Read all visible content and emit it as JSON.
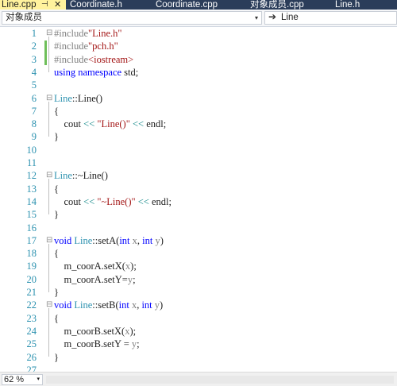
{
  "tabs": [
    {
      "label": "Line.cpp",
      "active": true
    },
    {
      "label": "Coordinate.h"
    },
    {
      "label": "Coordinate.cpp"
    },
    {
      "label": "对象成员.cpp"
    },
    {
      "label": "Line.h"
    }
  ],
  "tab_icons": {
    "pin": "pin-icon",
    "close": "close-icon"
  },
  "navbar": {
    "scope_label": "对象成员",
    "member_label": "Line",
    "dropdown_glyph": "▾",
    "member_arrow_glyph": "➔"
  },
  "editor": {
    "lines": [
      {
        "n": "1",
        "collapse": "⊟",
        "parts": [
          {
            "c": "pp",
            "t": "#include"
          },
          {
            "c": "str",
            "t": "\"Line.h\""
          }
        ]
      },
      {
        "n": "2",
        "parts": [
          {
            "c": "pp",
            "t": "#include"
          },
          {
            "c": "str",
            "t": "\"pch.h\""
          }
        ]
      },
      {
        "n": "3",
        "parts": [
          {
            "c": "pp",
            "t": "#include"
          },
          {
            "c": "str",
            "t": "<iostream>"
          }
        ]
      },
      {
        "n": "4",
        "parts": [
          {
            "c": "kw",
            "t": "using"
          },
          {
            "c": "",
            "t": " "
          },
          {
            "c": "kw",
            "t": "namespace"
          },
          {
            "c": "",
            "t": " std;"
          }
        ]
      },
      {
        "n": "5",
        "parts": []
      },
      {
        "n": "6",
        "collapse": "⊟",
        "parts": [
          {
            "c": "cls",
            "t": "Line"
          },
          {
            "c": "",
            "t": "::Line()"
          }
        ]
      },
      {
        "n": "7",
        "parts": [
          {
            "c": "",
            "t": "{"
          }
        ]
      },
      {
        "n": "8",
        "parts": [
          {
            "c": "",
            "t": "    cout "
          },
          {
            "c": "op",
            "t": "<<"
          },
          {
            "c": "",
            "t": " "
          },
          {
            "c": "str",
            "t": "\"Line()\""
          },
          {
            "c": "",
            "t": " "
          },
          {
            "c": "op",
            "t": "<<"
          },
          {
            "c": "",
            "t": " endl;"
          }
        ]
      },
      {
        "n": "9",
        "parts": [
          {
            "c": "",
            "t": "}"
          }
        ]
      },
      {
        "n": "10",
        "parts": []
      },
      {
        "n": "11",
        "parts": []
      },
      {
        "n": "12",
        "collapse": "⊟",
        "parts": [
          {
            "c": "cls",
            "t": "Line"
          },
          {
            "c": "",
            "t": "::~Line()"
          }
        ]
      },
      {
        "n": "13",
        "parts": [
          {
            "c": "",
            "t": "{"
          }
        ]
      },
      {
        "n": "14",
        "parts": [
          {
            "c": "",
            "t": "    cout "
          },
          {
            "c": "op",
            "t": "<<"
          },
          {
            "c": "",
            "t": " "
          },
          {
            "c": "str",
            "t": "\"~Line()\""
          },
          {
            "c": "",
            "t": " "
          },
          {
            "c": "op",
            "t": "<<"
          },
          {
            "c": "",
            "t": " endl;"
          }
        ]
      },
      {
        "n": "15",
        "parts": [
          {
            "c": "",
            "t": "}"
          }
        ]
      },
      {
        "n": "16",
        "parts": []
      },
      {
        "n": "17",
        "collapse": "⊟",
        "parts": [
          {
            "c": "kw",
            "t": "void"
          },
          {
            "c": "",
            "t": " "
          },
          {
            "c": "cls",
            "t": "Line"
          },
          {
            "c": "",
            "t": "::setA("
          },
          {
            "c": "kw",
            "t": "int"
          },
          {
            "c": "",
            "t": " "
          },
          {
            "c": "prm",
            "t": "x"
          },
          {
            "c": "",
            "t": ", "
          },
          {
            "c": "kw",
            "t": "int"
          },
          {
            "c": "",
            "t": " "
          },
          {
            "c": "prm",
            "t": "y"
          },
          {
            "c": "",
            "t": ")"
          }
        ]
      },
      {
        "n": "18",
        "parts": [
          {
            "c": "",
            "t": "{"
          }
        ]
      },
      {
        "n": "19",
        "parts": [
          {
            "c": "",
            "t": "    m_coorA.setX("
          },
          {
            "c": "prm",
            "t": "x"
          },
          {
            "c": "",
            "t": ");"
          }
        ]
      },
      {
        "n": "20",
        "parts": [
          {
            "c": "",
            "t": "    m_coorA.setY="
          },
          {
            "c": "prm",
            "t": "y"
          },
          {
            "c": "",
            "t": ";"
          }
        ]
      },
      {
        "n": "21",
        "parts": [
          {
            "c": "",
            "t": "}"
          }
        ]
      },
      {
        "n": "22",
        "collapse": "⊟",
        "parts": [
          {
            "c": "kw",
            "t": "void"
          },
          {
            "c": "",
            "t": " "
          },
          {
            "c": "cls",
            "t": "Line"
          },
          {
            "c": "",
            "t": "::setB("
          },
          {
            "c": "kw",
            "t": "int"
          },
          {
            "c": "",
            "t": " "
          },
          {
            "c": "prm",
            "t": "x"
          },
          {
            "c": "",
            "t": ", "
          },
          {
            "c": "kw",
            "t": "int"
          },
          {
            "c": "",
            "t": " "
          },
          {
            "c": "prm",
            "t": "y"
          },
          {
            "c": "",
            "t": ")"
          }
        ]
      },
      {
        "n": "23",
        "parts": [
          {
            "c": "",
            "t": "{"
          }
        ]
      },
      {
        "n": "24",
        "parts": [
          {
            "c": "",
            "t": "    m_coorB.setX("
          },
          {
            "c": "prm",
            "t": "x"
          },
          {
            "c": "",
            "t": ");"
          }
        ]
      },
      {
        "n": "25",
        "parts": [
          {
            "c": "",
            "t": "    m_coorB.setY = "
          },
          {
            "c": "prm",
            "t": "y"
          },
          {
            "c": "",
            "t": ";"
          }
        ]
      },
      {
        "n": "26",
        "parts": [
          {
            "c": "",
            "t": "}"
          }
        ]
      },
      {
        "n": "27",
        "parts": []
      }
    ]
  },
  "statusbar": {
    "zoom": "62 %",
    "dropdown_glyph": "▾"
  },
  "colors": {
    "tabbar_bg": "#2b3d5a",
    "active_tab_bg": "#fff29d",
    "keyword": "#0000ff",
    "string": "#a31515",
    "class": "#2b91af",
    "preprocessor": "#808080",
    "line_number": "#2b91af",
    "changed_line": "#6fbf5a"
  }
}
